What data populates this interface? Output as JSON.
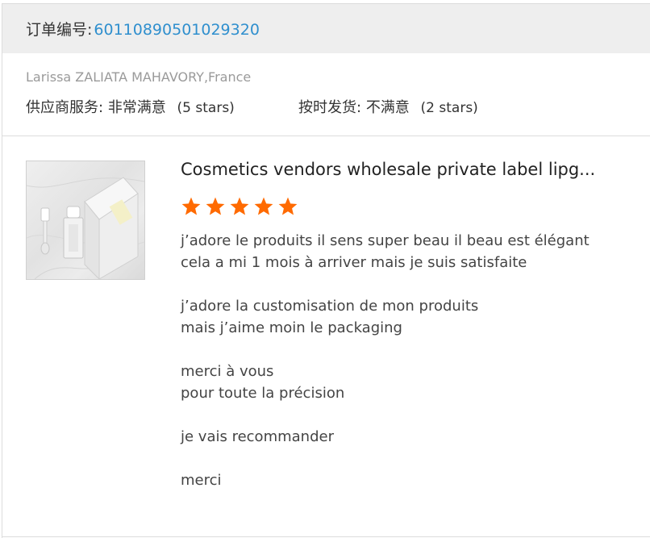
{
  "order": {
    "label": "订单编号:",
    "number": "60110890501029320"
  },
  "buyer": {
    "name": "Larissa ZALIATA MAHAVORY,France"
  },
  "ratings": {
    "supplier_service": {
      "label": "供应商服务:",
      "value": "非常满意",
      "stars_text": "(5 stars)"
    },
    "on_time_shipping": {
      "label": "按时发货:",
      "value": "不满意",
      "stars_text": "(2 stars)"
    }
  },
  "product": {
    "title": "Cosmetics vendors wholesale private label lipg...",
    "image_icon": "product-image-lipgloss",
    "rating": 5,
    "rating_max": 5,
    "star_color": "#ff6a00"
  },
  "review": {
    "lines": [
      "j’adore le produits il sens super beau il beau est élégant",
      "cela a mi 1 mois à arriver mais je suis satisfaite",
      "",
      "j’adore la customisation de mon produits",
      "mais j’aime moin le packaging",
      "",
      "merci à vous",
      "pour toute la précision",
      "",
      "je vais recommander",
      "",
      "merci"
    ]
  },
  "colors": {
    "accent_link": "#2f8fce",
    "header_bg": "#eeeeee",
    "muted_text": "#9a9a9a"
  }
}
